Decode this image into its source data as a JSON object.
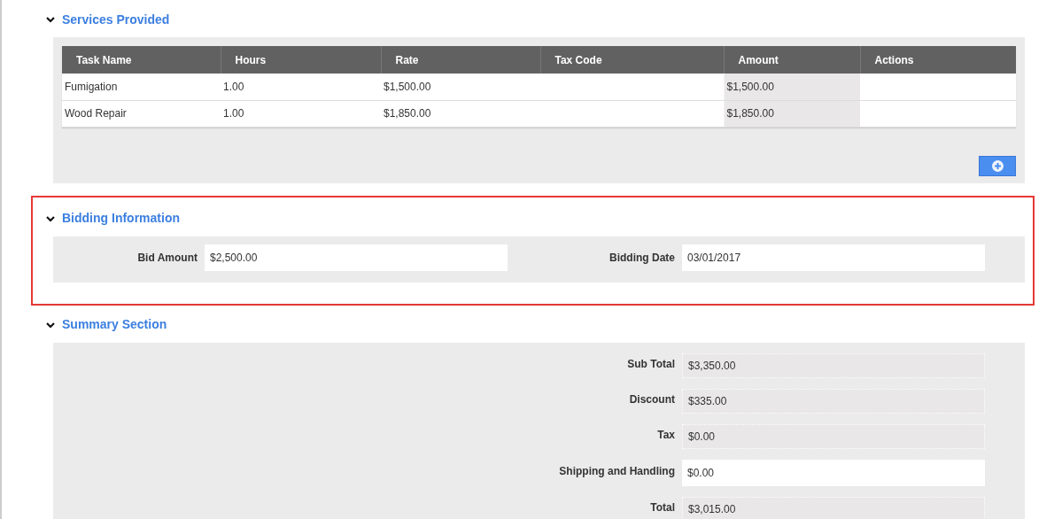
{
  "sections": [
    {
      "kind": "table",
      "title": "Services Provided",
      "expanded": true,
      "highlighted": false,
      "table": {
        "columns": [
          {
            "label": "Task Name",
            "readonly": false
          },
          {
            "label": "Hours",
            "readonly": false
          },
          {
            "label": "Rate",
            "readonly": false
          },
          {
            "label": "Tax Code",
            "readonly": false
          },
          {
            "label": "Amount",
            "readonly": true
          },
          {
            "label": "Actions",
            "readonly": false
          }
        ],
        "rows": [
          {
            "task_name": "Fumigation",
            "hours": "1.00",
            "rate": "$1,500.00",
            "amount": "$1,500.00"
          },
          {
            "task_name": "Wood Repair",
            "hours": "1.00",
            "rate": "$1,850.00",
            "amount": "$1,850.00"
          }
        ]
      }
    },
    {
      "kind": "pair",
      "title": "Bidding Information",
      "expanded": true,
      "highlighted": true,
      "fields": [
        {
          "label": "Bid Amount",
          "value": "$2,500.00",
          "readonly": false
        },
        {
          "label": "Bidding Date",
          "value": "03/01/2017",
          "readonly": false
        }
      ]
    },
    {
      "kind": "summary",
      "title": "Summary Section",
      "expanded": true,
      "highlighted": false,
      "fields": [
        {
          "label": "Sub Total",
          "value": "$3,350.00",
          "readonly": true
        },
        {
          "label": "Discount",
          "value": "$335.00",
          "readonly": true
        },
        {
          "label": "Tax",
          "value": "$0.00",
          "readonly": true
        },
        {
          "label": "Shipping and Handling",
          "value": "$0.00",
          "readonly": false
        },
        {
          "label": "Total",
          "value": "$3,015.00",
          "readonly": true
        }
      ]
    }
  ]
}
